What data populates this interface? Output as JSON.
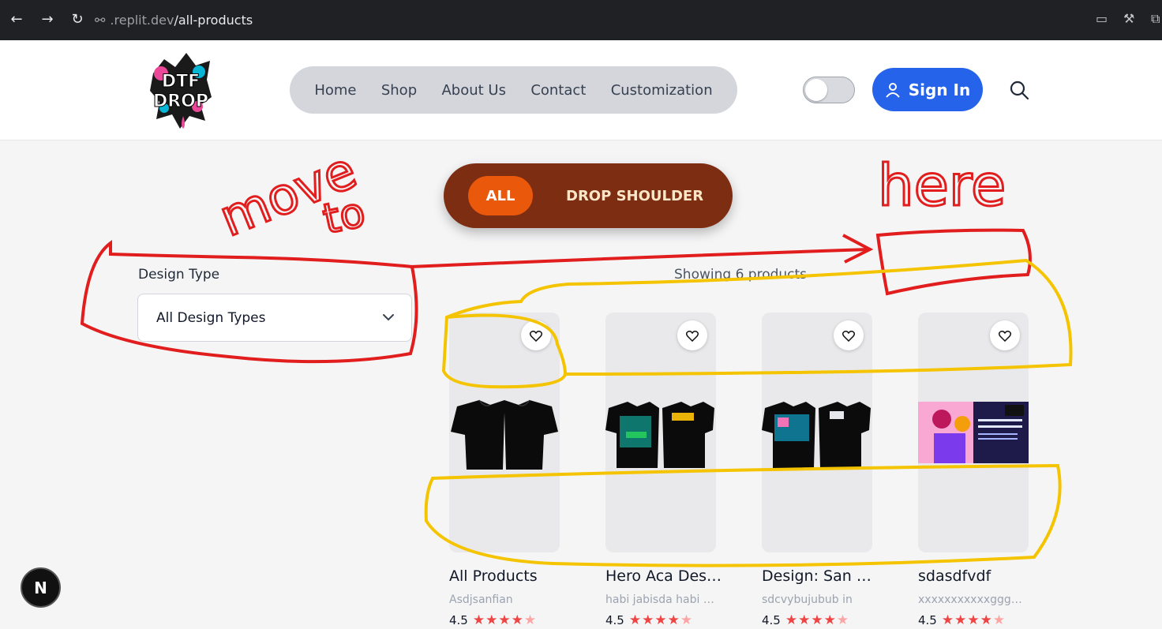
{
  "browser": {
    "url_prefix": ".replit.dev",
    "url_path": "/all-products"
  },
  "header": {
    "logo_text": [
      "DTF",
      "DROP"
    ],
    "nav": [
      "Home",
      "Shop",
      "About Us",
      "Contact",
      "Customization"
    ],
    "signin_label": "Sign In"
  },
  "filters": {
    "tabs": [
      "ALL",
      "DROP SHOULDER"
    ],
    "design_type_label": "Design Type",
    "design_type_value": "All Design Types",
    "showing": "Showing 6 products"
  },
  "products": [
    {
      "title": "All Products",
      "sub": "Asdjsanfian",
      "rating": "4.5"
    },
    {
      "title": "Hero Aca Design",
      "sub": "habi jabisda habi jabisda",
      "rating": "4.5"
    },
    {
      "title": "Design: San Andreas",
      "sub": "sdcvybujubub in",
      "rating": "4.5"
    },
    {
      "title": "sdasdfvdf",
      "sub": "xxxxxxxxxxxgggggggg",
      "rating": "4.5"
    }
  ],
  "annotations": {
    "move_to": [
      "move",
      "to"
    ],
    "here": "here"
  },
  "colors": {
    "accent_blue": "#2563eb",
    "filter_bg": "#7c2d12",
    "filter_active": "#ea580c",
    "annotation_red": "#e11d1d",
    "annotation_yellow": "#f5c400"
  },
  "badge": "N"
}
